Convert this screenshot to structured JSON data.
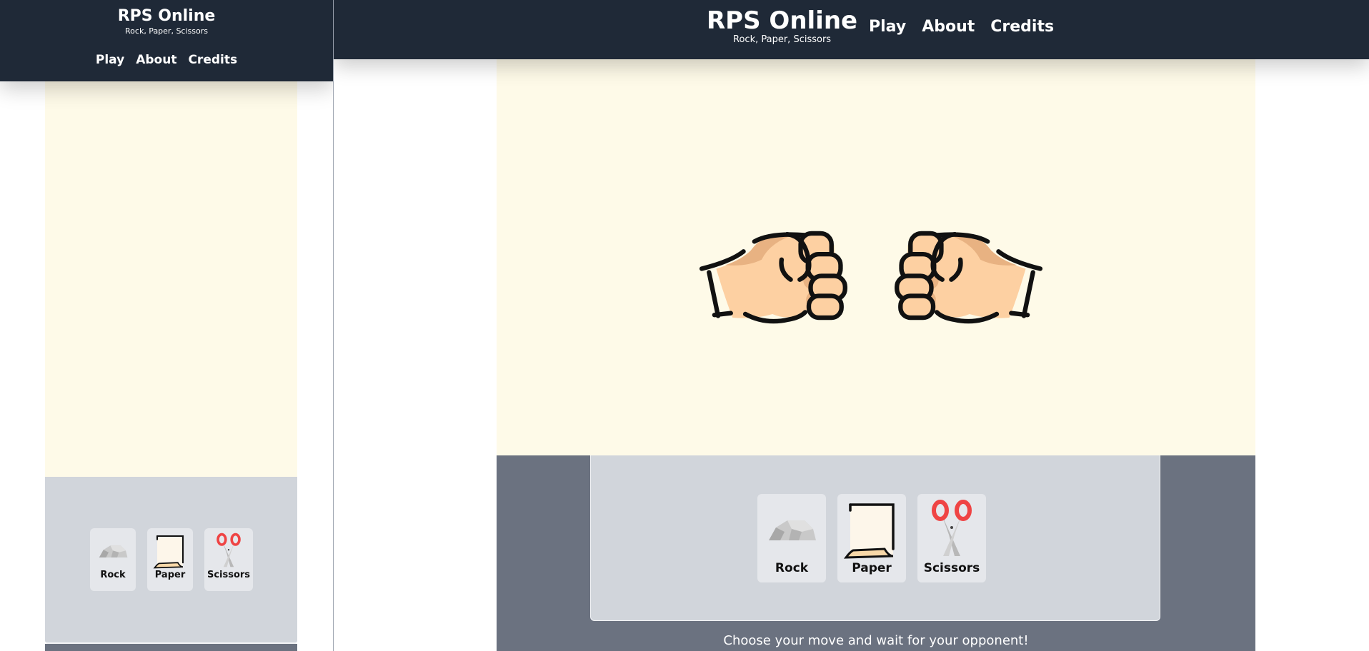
{
  "brand": {
    "title": "RPS Online",
    "subtitle": "Rock, Paper, Scissors"
  },
  "nav": [
    {
      "label": "Play"
    },
    {
      "label": "About"
    },
    {
      "label": "Credits"
    }
  ],
  "choices": [
    {
      "label": "Rock",
      "icon": "rock-icon"
    },
    {
      "label": "Paper",
      "icon": "paper-icon"
    },
    {
      "label": "Scissors",
      "icon": "scissors-icon"
    }
  ],
  "status": {
    "message": "Choose your move and wait for your opponent!"
  },
  "colors": {
    "header_bg": "#1f2937",
    "stage_bg": "#fefae8",
    "controls_bg": "#d1d5db",
    "choice_bg": "#e5e7eb",
    "footer_bg": "#6b7280",
    "skin": "#fdd0a2",
    "skin_shadow": "#e8b282",
    "scissors_handle": "#ef4444"
  },
  "players": {
    "left_hand": "fist-icon",
    "right_hand": "fist-icon"
  }
}
